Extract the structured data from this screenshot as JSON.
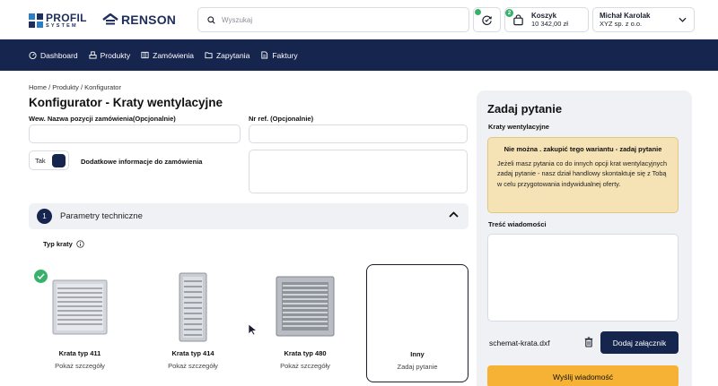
{
  "header": {
    "logo_primary": "PROFIL",
    "logo_secondary": "SYSTEM",
    "partner_logo": "RENSON",
    "search": {
      "placeholder": "Wyszukaj",
      "value": ""
    },
    "favorites": {
      "icon": "refresh-check-icon",
      "status_color": "#38b26b"
    },
    "cart": {
      "label": "Koszyk",
      "total": "10 342,00 zł",
      "badge": "2"
    },
    "user": {
      "name": "Michał Karolak",
      "company": "XYZ sp. z o.o."
    }
  },
  "nav": {
    "items": [
      {
        "label": "Dashboard",
        "icon": "dashboard-icon"
      },
      {
        "label": "Produkty",
        "icon": "products-icon"
      },
      {
        "label": "Zamówienia",
        "icon": "orders-icon"
      },
      {
        "label": "Zapytania",
        "icon": "folder-icon"
      },
      {
        "label": "Faktury",
        "icon": "invoice-icon"
      }
    ]
  },
  "breadcrumb": "Home / Produkty / Konfigurator",
  "page_title": "Konfigurator - Kraty wentylacyjne",
  "form": {
    "name_label": "Wew. Nazwa pozycji zamówienia(Opcjonalnie)",
    "name_value": "",
    "ref_label": "Nr ref. (Opcjonalnie)",
    "ref_value": "",
    "toggle_label": "Tak",
    "extra_info_label": "Dodatkowe informacje do zamówienia",
    "extra_info_value": ""
  },
  "section": {
    "number": "1",
    "title": "Parametry techniczne"
  },
  "grate_types": {
    "label": "Typ kraty",
    "cards": [
      {
        "title": "Krata typ 411",
        "subtitle": "Pokaż szczegóły",
        "selected": true
      },
      {
        "title": "Krata typ 414",
        "subtitle": "Pokaż szczegóły",
        "selected": false
      },
      {
        "title": "Krata typ 480",
        "subtitle": "Pokaż szczegóły",
        "selected": false
      },
      {
        "title": "Inny",
        "subtitle": "Zadaj pytanie",
        "selected": false
      }
    ]
  },
  "question_panel": {
    "title": "Zadaj pytanie",
    "subtitle": "Kraty wentylacyjne",
    "warning_title": "Nie można . zakupić tego wariantu - zadaj pytanie",
    "warning_text": "Jeżeli masz pytania co do innych opcji krat wentylacyjnych zadaj pytanie - nasz dział handlowy skontaktuje się z Tobą w celu przygotowania indywidualnej oferty.",
    "message_label": "Treść wiadomości",
    "message_value": "",
    "attachment_name": "schemat-krata.dxf",
    "attach_button": "Dodaj załącznik",
    "send_button": "Wyślij wiadomość"
  },
  "colors": {
    "navy": "#15254e",
    "accent": "#f5b234",
    "success": "#38b26b",
    "warning_bg": "#f6e3b5"
  }
}
